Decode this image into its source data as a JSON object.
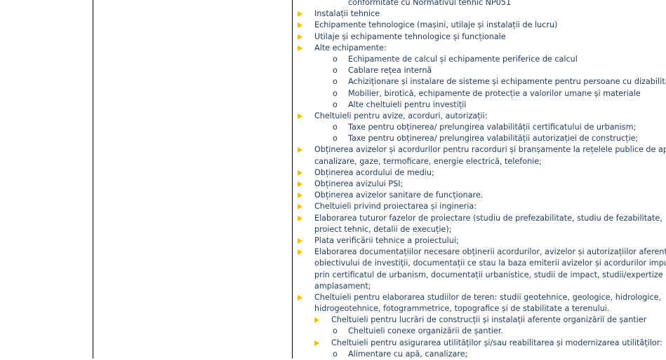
{
  "document": {
    "items": [
      {
        "kind": "circle",
        "text": "conformitate cu Normativul tehnic NP051"
      },
      {
        "kind": "bullet",
        "text": "Instalații tehnice"
      },
      {
        "kind": "bullet",
        "text": "Echipamente tehnologice (mașini, utilaje și instalații de lucru)"
      },
      {
        "kind": "bullet",
        "text": "Utilaje și echipamente tehnologice și funcționale"
      },
      {
        "kind": "bullet",
        "text": "Alte echipamente:"
      },
      {
        "kind": "circle",
        "marker": "o",
        "text": "Echipamente de calcul și echipamente periferice de calcul"
      },
      {
        "kind": "circle",
        "marker": "o",
        "text": "Cablare rețea internă"
      },
      {
        "kind": "circle",
        "marker": "o",
        "text": "Achiziționare și instalare de sisteme și echipamente pentru persoane cu dizabilități"
      },
      {
        "kind": "circle",
        "marker": "o",
        "text": "Mobilier, birotică, echipamente de protecție a valorilor umane și materiale"
      },
      {
        "kind": "circle",
        "marker": "o",
        "text": "Alte cheltuieli pentru investiții"
      },
      {
        "kind": "bullet",
        "text": "Cheltuieli pentru avize, acorduri, autorizații:"
      },
      {
        "kind": "circle",
        "marker": "o",
        "text": "Taxe pentru obținerea/ prelungirea valabilității certificatului de urbanism;"
      },
      {
        "kind": "circle",
        "marker": "o",
        "text": "Taxe pentru obținerea/ prelungirea valabilității autorizației de construcție;"
      },
      {
        "kind": "bullet",
        "text": "Obținerea avizelor și acordurilor pentru racorduri și branșamente la rețelele publice de apă,"
      },
      {
        "kind": "cont",
        "text": "canalizare, gaze, termoficare, energie electrică, telefonie;"
      },
      {
        "kind": "bullet",
        "text": "Obținerea acordului de mediu;"
      },
      {
        "kind": "bullet",
        "text": "Obținerea avizului PSI;"
      },
      {
        "kind": "bullet",
        "text": "Obținerea avizelor sanitare de funcționare."
      },
      {
        "kind": "bullet",
        "text": "Cheltuieli privind proiectarea și ingineria:"
      },
      {
        "kind": "bullet",
        "text": "Elaborarea tuturor fazelor de proiectare (studiu de prefezabilitate, studiu de fezabilitate,"
      },
      {
        "kind": "cont",
        "text": "proiect tehnic, detalii de execuție);"
      },
      {
        "kind": "bullet",
        "text": "Plata verificării tehnice a proiectului;"
      },
      {
        "kind": "bullet",
        "text": "Elaborarea documentațiilor necesare obținerii acordurilor, avizelor și autorizațiilor aferente"
      },
      {
        "kind": "cont",
        "text": "obiectivului de investiții, documentații ce stau la baza emiterii avizelor și acordurilor impuse"
      },
      {
        "kind": "cont",
        "text": "prin certificatul de urbanism, documentații urbanistice, studii de impact, studii/expertize de"
      },
      {
        "kind": "cont",
        "text": "amplasament;"
      },
      {
        "kind": "bullet",
        "text": "Cheltuieli pentru elaborarea studiilor de teren: studii geotehnice, geologice, hidrologice,"
      },
      {
        "kind": "cont",
        "text": "hidrogeotehnice, fotogrammetrice, topografice și de stabilitate a terenului."
      },
      {
        "kind": "subbullet",
        "text": "Cheltuieli pentru lucrări de construcții și instalații aferente organizării de șantier"
      },
      {
        "kind": "circle",
        "marker": "o",
        "text": "Cheltuieli conexe organizării de șantier."
      },
      {
        "kind": "subbullet",
        "text": "Cheltuieli pentru asigurarea utilităților și/sau reabilitarea și modernizarea utilităților:"
      },
      {
        "kind": "circle",
        "marker": "o",
        "text": "Alimentare cu apă, canalizare;"
      }
    ]
  }
}
